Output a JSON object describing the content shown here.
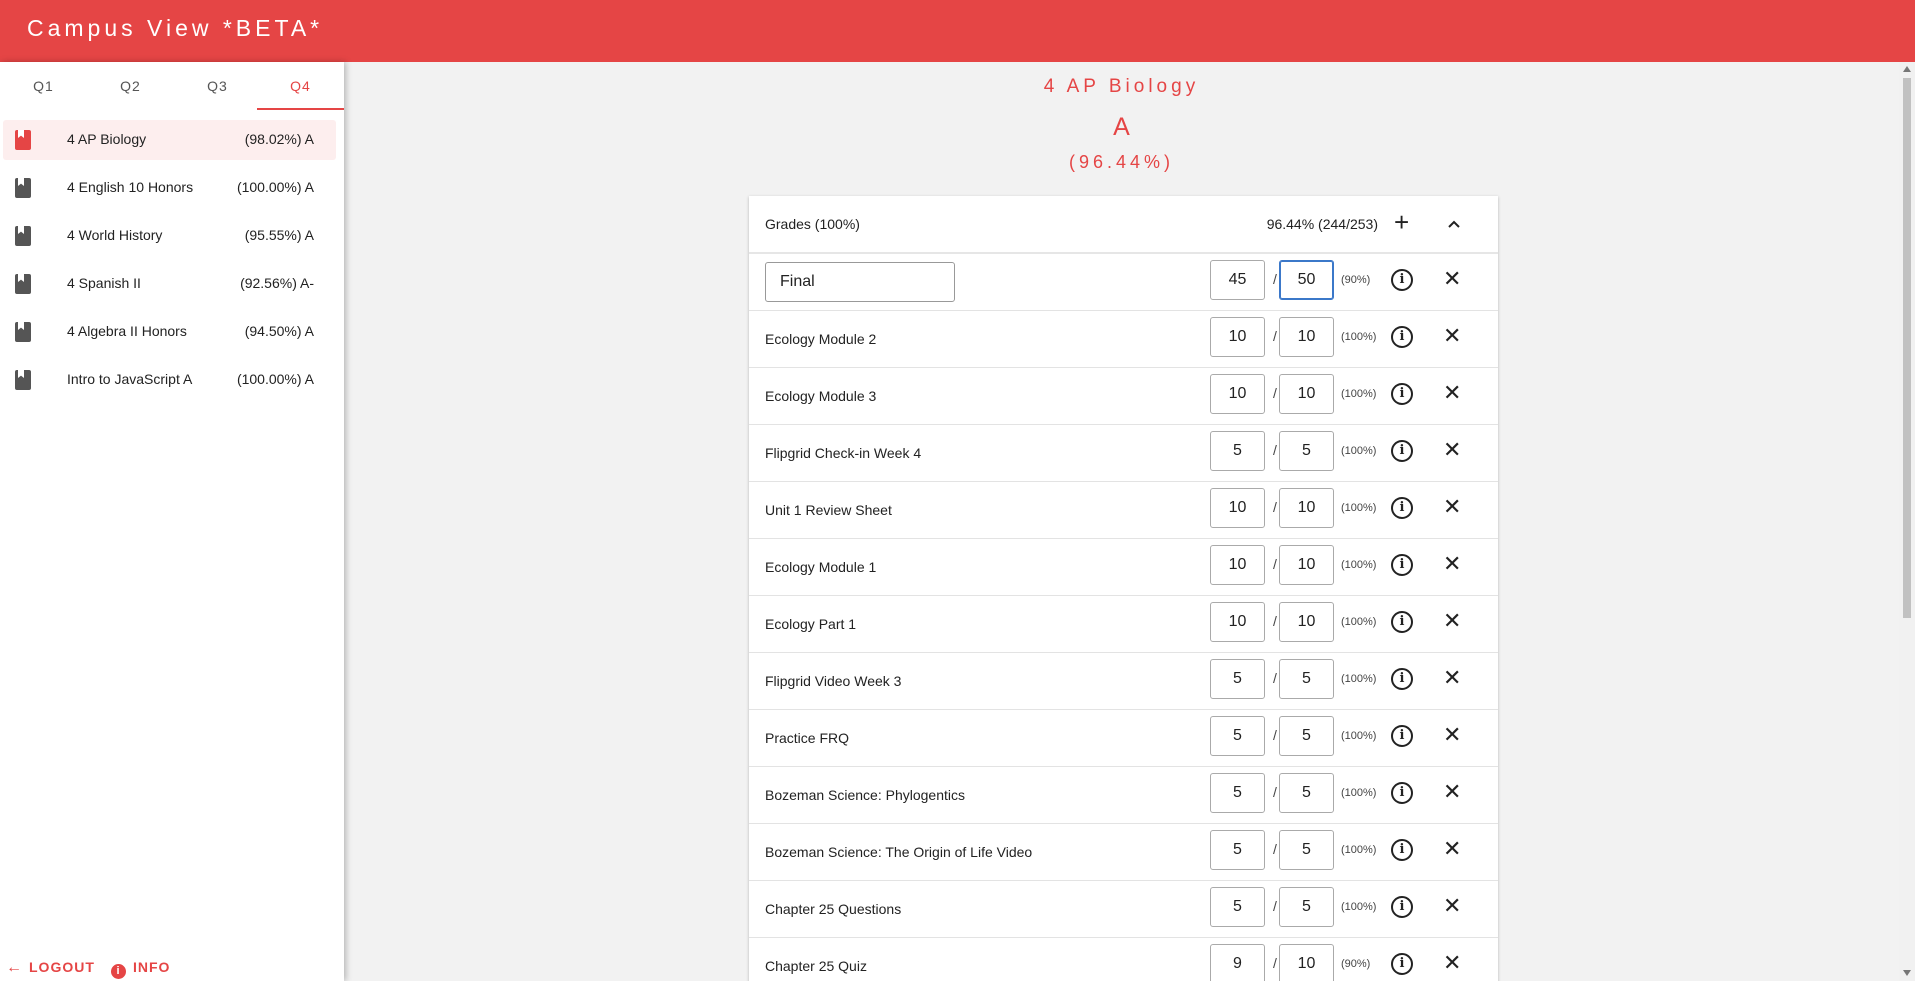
{
  "app": {
    "title": "Campus View *BETA*",
    "accent_color": "#e54545"
  },
  "tabs": [
    {
      "label": "Q1",
      "active": false
    },
    {
      "label": "Q2",
      "active": false
    },
    {
      "label": "Q3",
      "active": false
    },
    {
      "label": "Q4",
      "active": true
    }
  ],
  "courses": [
    {
      "name": "4 AP Biology",
      "grade": "(98.02%) A",
      "active": true,
      "icon": "book-icon"
    },
    {
      "name": "4 English 10 Honors",
      "grade": "(100.00%) A",
      "active": false,
      "icon": "book-icon"
    },
    {
      "name": "4 World History",
      "grade": "(95.55%) A",
      "active": false,
      "icon": "book-icon"
    },
    {
      "name": "4 Spanish II",
      "grade": "(92.56%) A-",
      "active": false,
      "icon": "book-icon"
    },
    {
      "name": "4 Algebra II Honors",
      "grade": "(94.50%) A",
      "active": false,
      "icon": "book-icon"
    },
    {
      "name": "Intro to JavaScript A",
      "grade": "(100.00%) A",
      "active": false,
      "icon": "book-icon"
    }
  ],
  "footer": {
    "logout_label": "LOGOUT",
    "info_label": "INFO"
  },
  "main": {
    "course_title": "4 AP Biology",
    "letter_grade": "A",
    "percent": "(96.44%)",
    "category": {
      "label": "Grades (100%)",
      "total": "96.44% (244/253)"
    },
    "assignments": [
      {
        "name": "Final",
        "score": "45",
        "max": "50",
        "pct": "(90%)",
        "editing": true
      },
      {
        "name": "Ecology Module 2",
        "score": "10",
        "max": "10",
        "pct": "(100%)"
      },
      {
        "name": "Ecology Module 3",
        "score": "10",
        "max": "10",
        "pct": "(100%)"
      },
      {
        "name": "Flipgrid Check-in Week 4",
        "score": "5",
        "max": "5",
        "pct": "(100%)"
      },
      {
        "name": "Unit 1 Review Sheet",
        "score": "10",
        "max": "10",
        "pct": "(100%)"
      },
      {
        "name": "Ecology Module 1",
        "score": "10",
        "max": "10",
        "pct": "(100%)"
      },
      {
        "name": "Ecology Part 1",
        "score": "10",
        "max": "10",
        "pct": "(100%)"
      },
      {
        "name": "Flipgrid Video Week 3",
        "score": "5",
        "max": "5",
        "pct": "(100%)"
      },
      {
        "name": "Practice FRQ",
        "score": "5",
        "max": "5",
        "pct": "(100%)"
      },
      {
        "name": "Bozeman Science: Phylogentics",
        "score": "5",
        "max": "5",
        "pct": "(100%)"
      },
      {
        "name": "Bozeman Science: The Origin of Life Video",
        "score": "5",
        "max": "5",
        "pct": "(100%)"
      },
      {
        "name": "Chapter 25 Questions",
        "score": "5",
        "max": "5",
        "pct": "(100%)"
      },
      {
        "name": "Chapter 25 Quiz",
        "score": "9",
        "max": "10",
        "pct": "(90%)"
      }
    ]
  }
}
